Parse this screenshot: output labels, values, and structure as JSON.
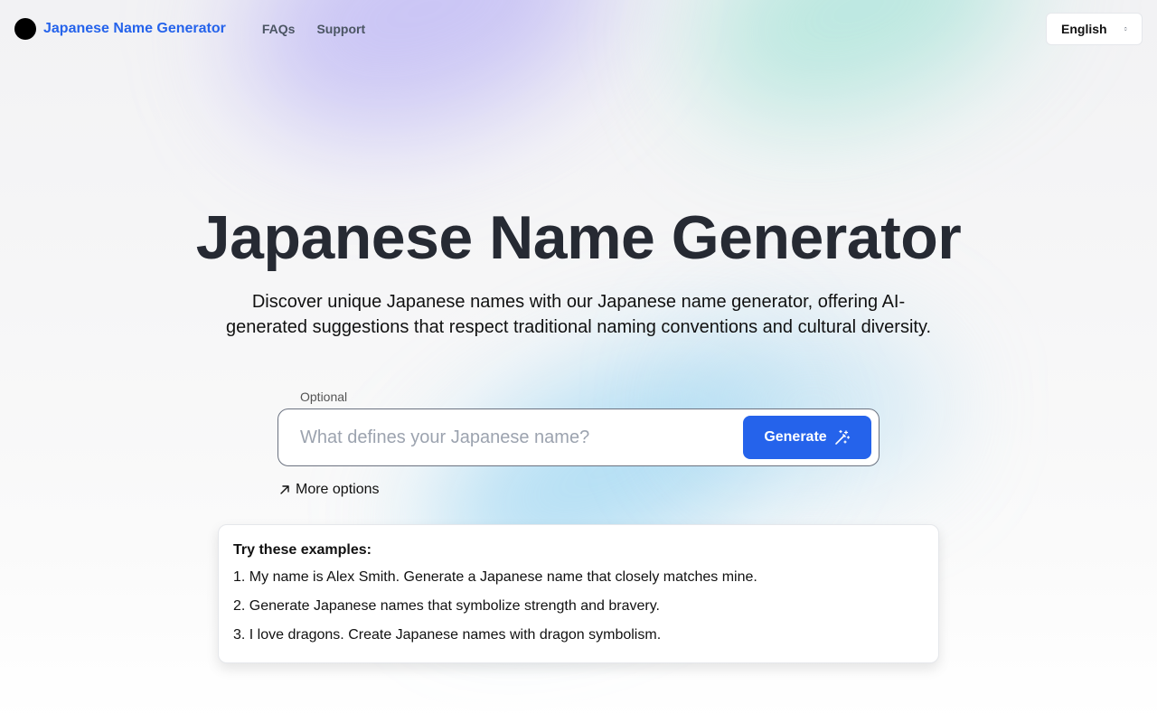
{
  "nav": {
    "brand": "Japanese Name Generator",
    "links": [
      "FAQs",
      "Support"
    ],
    "language": "English"
  },
  "hero": {
    "title": "Japanese Name Generator",
    "subtitle": "Discover unique Japanese names with our Japanese name generator, offering AI-generated suggestions that respect traditional naming conventions and cultural diversity."
  },
  "form": {
    "optional_label": "Optional",
    "input_placeholder": "What defines your Japanese name?",
    "input_value": "",
    "generate_label": "Generate",
    "more_options_label": "More options"
  },
  "examples": {
    "heading": "Try these examples:",
    "items": [
      "1. My name is Alex Smith. Generate a Japanese name that closely matches mine.",
      "2. Generate Japanese names that symbolize strength and bravery.",
      "3. I love dragons. Create Japanese names with dragon symbolism."
    ]
  },
  "colors": {
    "accent": "#2563eb",
    "title": "#262a33"
  },
  "icons": {
    "logo": "logo-circle-icon",
    "language_toggle": "chevron-up-down-icon",
    "generate": "magic-wand-icon",
    "more_options": "arrow-up-right-icon"
  }
}
